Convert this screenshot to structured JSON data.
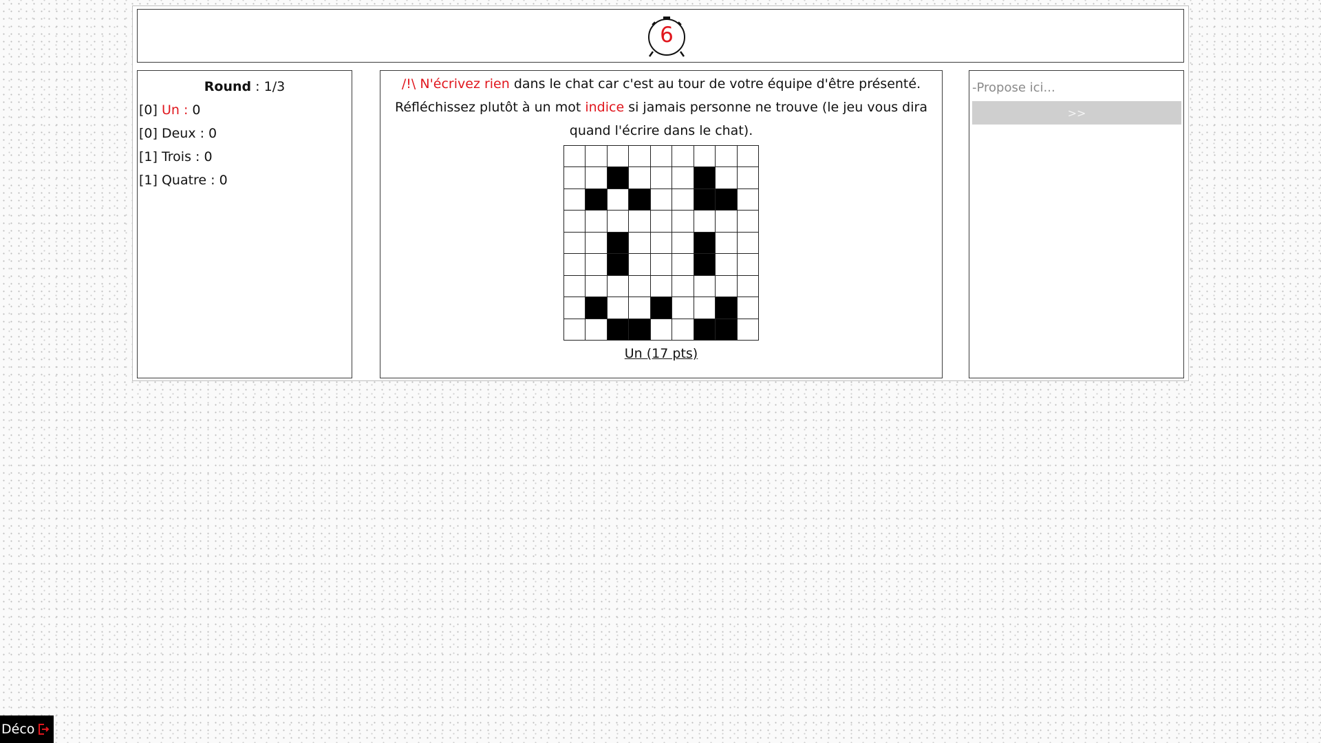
{
  "timer": {
    "value": "6",
    "color": "#e0161d"
  },
  "scoreboard": {
    "round_label": "Round",
    "round_value": " : 1/3",
    "teams": [
      {
        "prefix": "[0] ",
        "name": "Un",
        "suffix": " : 0",
        "highlight": true
      },
      {
        "prefix": "[0] ",
        "name": "Deux",
        "suffix": " : 0",
        "highlight": false
      },
      {
        "prefix": "[1] ",
        "name": "Trois",
        "suffix": " : 0",
        "highlight": false
      },
      {
        "prefix": "[1] ",
        "name": "Quatre",
        "suffix": " : 0",
        "highlight": false
      }
    ]
  },
  "instructions": {
    "warning": "/!\\ N'écrivez rien",
    "line1_rest": " dans le chat car c'est au tour de votre équipe d'être présenté.",
    "line2_start": "Réfléchissez plutôt à un mot ",
    "keyword": "indice",
    "line2_rest": " si jamais personne ne trouve (le jeu vous dira quand l'écrire dans le chat)."
  },
  "pixel_grid": {
    "size": 9,
    "rows": [
      "000000000",
      "001000100",
      "010100110",
      "000000000",
      "001000100",
      "001000100",
      "000000000",
      "010010010",
      "001100110"
    ]
  },
  "drawer_label": "Un (17 pts)",
  "chat": {
    "placeholder": "-Propose ici...",
    "send_label": ">>"
  },
  "deco_button": {
    "label": "Déco",
    "icon": "logout-icon"
  }
}
